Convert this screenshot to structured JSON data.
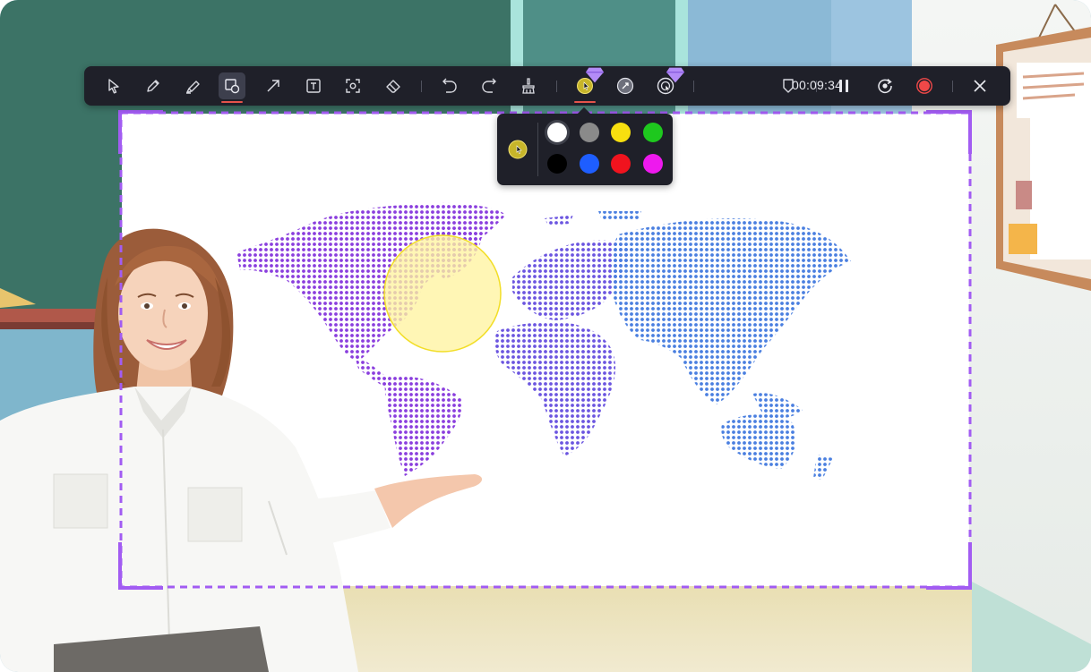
{
  "toolbar": {
    "tools": [
      {
        "name": "select-tool",
        "icon": "cursor-arrow-icon"
      },
      {
        "name": "pen-tool",
        "icon": "pen-icon"
      },
      {
        "name": "highlighter-tool",
        "icon": "highlighter-icon"
      },
      {
        "name": "shape-tool",
        "icon": "shapes-icon",
        "active": true
      },
      {
        "name": "arrow-tool",
        "icon": "arrow-icon"
      },
      {
        "name": "text-tool",
        "icon": "text-box-icon"
      },
      {
        "name": "spotlight-tool",
        "icon": "focus-frame-icon"
      },
      {
        "name": "eraser-tool",
        "icon": "eraser-icon"
      },
      {
        "name": "undo",
        "icon": "undo-icon"
      },
      {
        "name": "redo",
        "icon": "redo-icon"
      },
      {
        "name": "clear-all",
        "icon": "broom-icon"
      },
      {
        "name": "cursor-highlight",
        "icon": "cursor-highlight-icon",
        "active": true,
        "pro": true
      },
      {
        "name": "mouse-click-effect",
        "icon": "click-effect-icon"
      },
      {
        "name": "mouse-click-sound",
        "icon": "click-ring-icon",
        "pro": true
      },
      {
        "name": "watermark",
        "icon": "shield-icon"
      },
      {
        "name": "pause",
        "icon": "pause-icon"
      },
      {
        "name": "restart",
        "icon": "restart-icon"
      },
      {
        "name": "stop-recording",
        "icon": "record-stop-icon"
      },
      {
        "name": "close",
        "icon": "close-icon"
      }
    ],
    "timer": "00:09:34"
  },
  "color_picker": {
    "current_color": "#d8c72a",
    "swatches": [
      {
        "name": "white",
        "color": "#ffffff",
        "selected": true
      },
      {
        "name": "gray",
        "color": "#8a8a8a"
      },
      {
        "name": "yellow",
        "color": "#f7df0f"
      },
      {
        "name": "green",
        "color": "#1ec81e"
      },
      {
        "name": "black",
        "color": "#000000"
      },
      {
        "name": "blue",
        "color": "#1e5eff"
      },
      {
        "name": "red",
        "color": "#f0131e"
      },
      {
        "name": "magenta",
        "color": "#ee19ee"
      }
    ]
  },
  "colors": {
    "toolbar_bg": "#1f2029",
    "accent_underline": "#e5534b",
    "capture_border": "#a25cf2",
    "spotlight_fill": "#fff3a0",
    "map_west": "#8a3ede",
    "map_east": "#4a7fe0",
    "chalkboard": "#3c7366"
  }
}
